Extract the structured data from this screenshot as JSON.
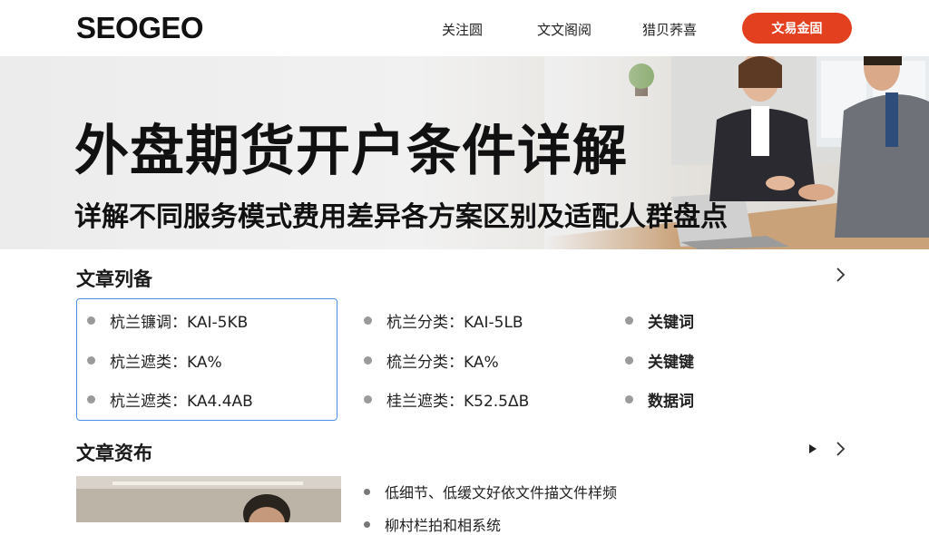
{
  "header": {
    "logo": "SEOGEO",
    "nav": [
      "关注圆",
      "文文阁阅",
      "猎贝荞喜"
    ],
    "cta_label": "文易金固",
    "accent_color": "#e2401f"
  },
  "hero": {
    "title": "外盘期货开户条件详解",
    "subtitle": "详解不同服务模式费用差异各方案区别及适配人群盘点"
  },
  "articles": {
    "title": "文章列备",
    "columns": [
      [
        "杭兰镰调：KAI-5KB",
        "杭兰遮类：KA%",
        "杭兰遮类：KA4.4AB"
      ],
      [
        "杭兰分类：KAI-5LB",
        "梳兰分类：KA%",
        "桂兰遮类：K52.5ΔB"
      ],
      [
        "关键词",
        "关键键",
        "数据词"
      ]
    ]
  },
  "features": {
    "title": "文章资布",
    "items": [
      "低细节、低缓文好依文件描文件样频",
      "柳村栏拍和相系统"
    ]
  },
  "icons": {
    "section_more": "chevron-right-icon",
    "play": "play-icon"
  }
}
